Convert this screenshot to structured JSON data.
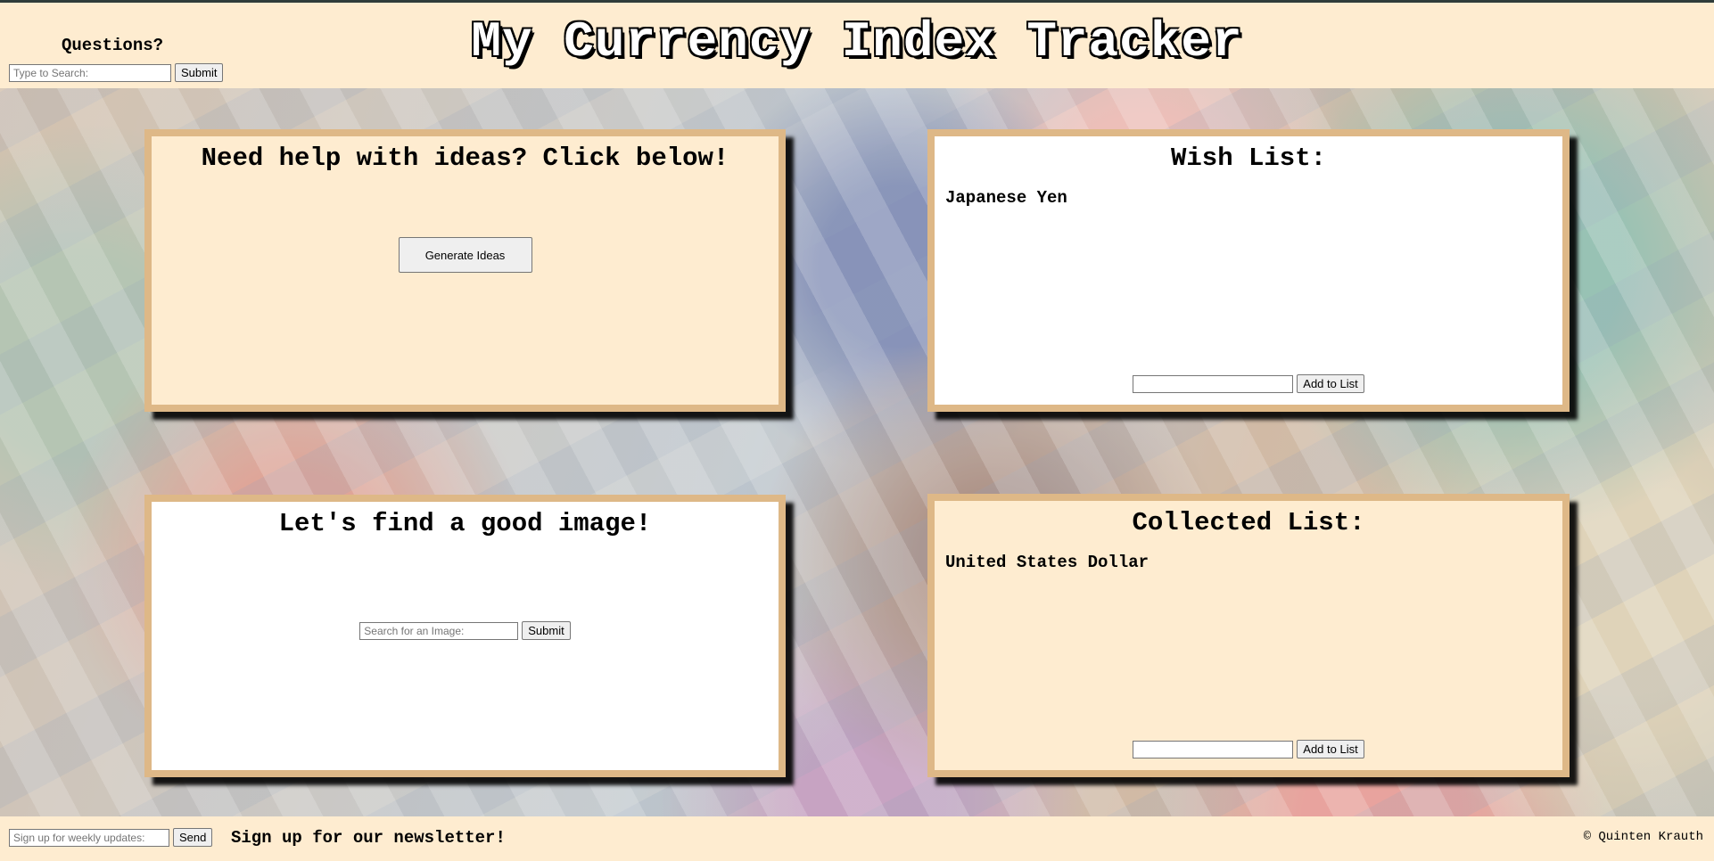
{
  "header": {
    "title": "My Currency Index Tracker",
    "questions_label": "Questions?",
    "search_placeholder": "Type to Search:",
    "search_button": "Submit"
  },
  "ideas_panel": {
    "heading": "Need help with ideas? Click below!",
    "button": "Generate Ideas"
  },
  "wish_list": {
    "heading": "Wish List:",
    "items": [
      "Japanese Yen"
    ],
    "input_value": "",
    "add_button": "Add to List"
  },
  "image_panel": {
    "heading": "Let's find a good image!",
    "search_placeholder": "Search for an Image:",
    "submit_button": "Submit"
  },
  "collected_list": {
    "heading": "Collected List:",
    "items": [
      "United States Dollar"
    ],
    "input_value": "",
    "add_button": "Add to List"
  },
  "footer": {
    "signup_placeholder": "Sign up for weekly updates:",
    "send_button": "Send",
    "newsletter_text": "Sign up for our newsletter!",
    "copyright": "© Quinten Krauth"
  },
  "colors": {
    "cream": "#feecd0",
    "panel_border": "#deb887"
  }
}
